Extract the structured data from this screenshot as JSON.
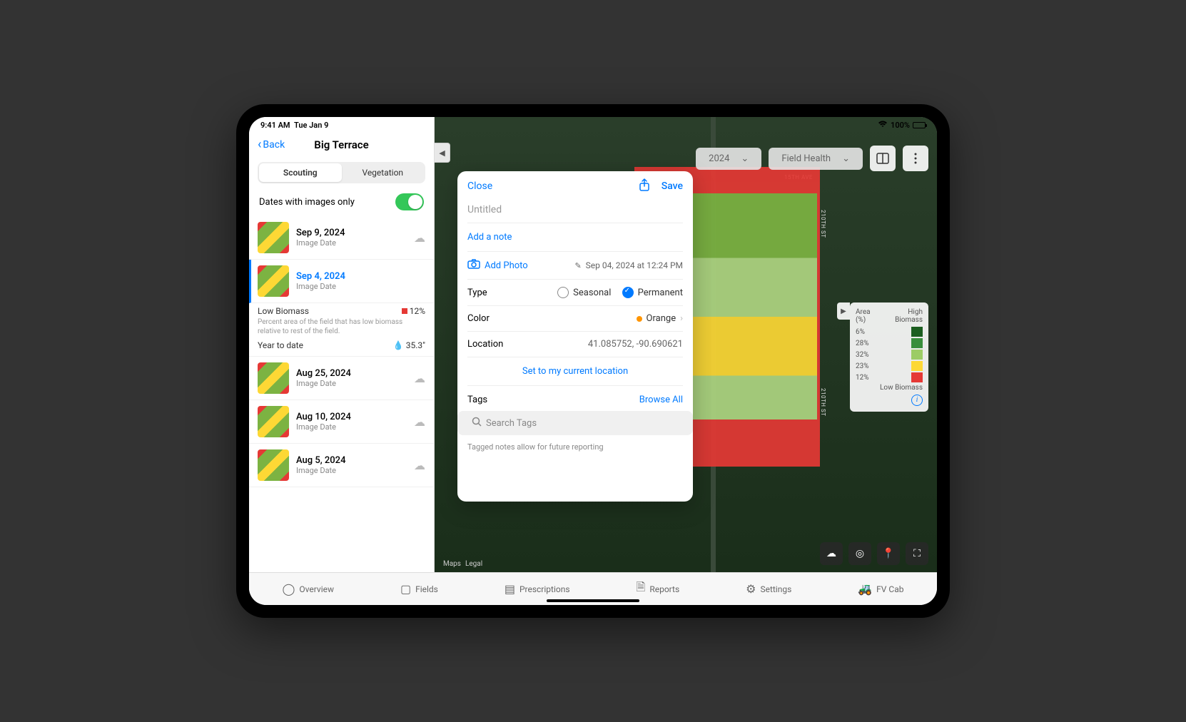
{
  "status": {
    "time": "9:41 AM",
    "date": "Tue Jan 9",
    "wifi": "100%"
  },
  "panel": {
    "back": "Back",
    "title": "Big Terrace",
    "tabs": {
      "scouting": "Scouting",
      "vegetation": "Vegetation"
    },
    "toggle_label": "Dates with images only",
    "biomass": {
      "label": "Low Biomass",
      "value": "12%",
      "desc": "Percent area of the field that has low biomass relative to rest of the field.",
      "ytd_label": "Year to date",
      "ytd_value": "35.3\""
    },
    "dates": [
      {
        "date": "Sep 9, 2024",
        "sub": "Image Date",
        "cloud": true
      },
      {
        "date": "Sep 4, 2024",
        "sub": "Image Date",
        "selected": true
      },
      {
        "date": "Aug 25, 2024",
        "sub": "Image Date",
        "cloud": true
      },
      {
        "date": "Aug 10, 2024",
        "sub": "Image Date",
        "cloud": true
      },
      {
        "date": "Aug 5, 2024",
        "sub": "Image Date",
        "cloud": true
      }
    ]
  },
  "map_controls": {
    "year": "2024",
    "layer": "Field Health"
  },
  "roads": {
    "ave": "15TH AVE",
    "st": "210TH ST"
  },
  "legend": {
    "area_label": "Area (%)",
    "high": "High Biomass",
    "low": "Low Biomass",
    "rows": [
      {
        "pct": "6%",
        "color": "#1b5e20"
      },
      {
        "pct": "28%",
        "color": "#388e3c"
      },
      {
        "pct": "32%",
        "color": "#9ccc65"
      },
      {
        "pct": "23%",
        "color": "#fdd835"
      },
      {
        "pct": "12%",
        "color": "#e53935"
      }
    ]
  },
  "popover": {
    "close": "Close",
    "save": "Save",
    "title_placeholder": "Untitled",
    "add_note": "Add a note",
    "add_photo": "Add Photo",
    "timestamp": "Sep 04, 2024 at 12:24 PM",
    "type_label": "Type",
    "seasonal": "Seasonal",
    "permanent": "Permanent",
    "color_label": "Color",
    "color_value": "Orange",
    "location_label": "Location",
    "location_value": "41.085752, -90.690621",
    "set_location": "Set to my current location",
    "tags_label": "Tags",
    "browse_all": "Browse All",
    "search_placeholder": "Search Tags",
    "tag_hint": "Tagged notes allow for future reporting"
  },
  "maps_attr": {
    "logo": "Maps",
    "legal": "Legal"
  },
  "tabs": {
    "overview": "Overview",
    "fields": "Fields",
    "prescriptions": "Prescriptions",
    "reports": "Reports",
    "settings": "Settings",
    "fvcab": "FV Cab"
  }
}
